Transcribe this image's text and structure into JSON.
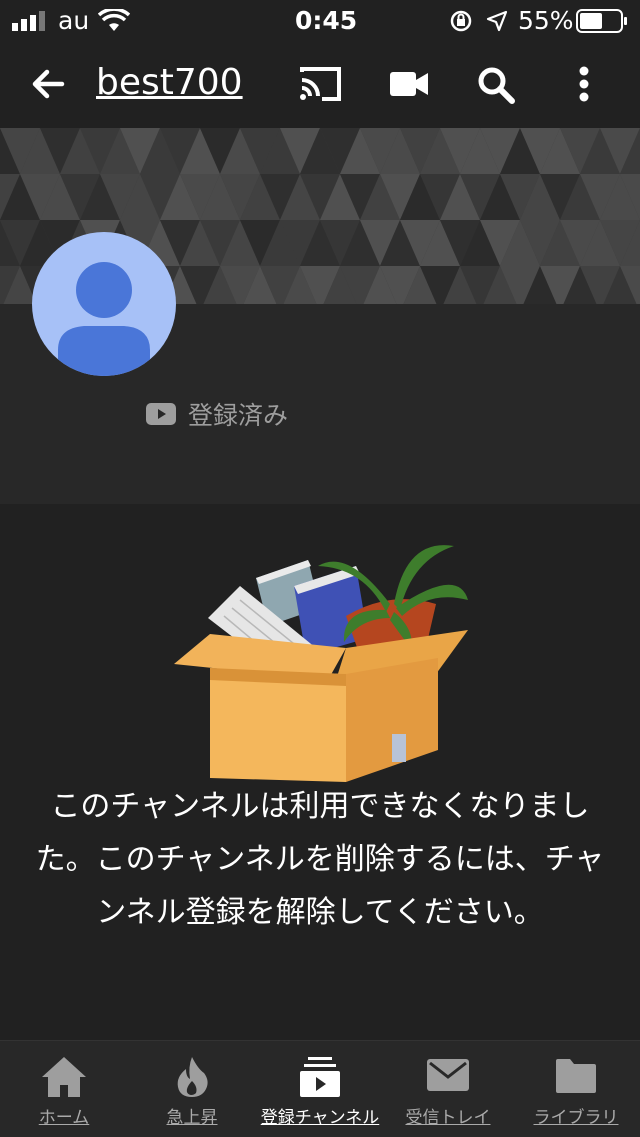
{
  "status_bar": {
    "carrier": "au",
    "time": "0:45",
    "battery": "55%"
  },
  "app_bar": {
    "title": "best700"
  },
  "channel": {
    "subscribe_status": "登録済み"
  },
  "message": "このチャンネルは利用できなくなりました。このチャンネルを削除するには、チャンネル登録を解除してください。",
  "bottom_nav": {
    "items": [
      {
        "label": "ホーム",
        "icon": "home-icon"
      },
      {
        "label": "急上昇",
        "icon": "flame-icon"
      },
      {
        "label": "登録チャンネル",
        "icon": "subscriptions-icon",
        "active": true
      },
      {
        "label": "受信トレイ",
        "icon": "mail-icon"
      },
      {
        "label": "ライブラリ",
        "icon": "folder-icon"
      }
    ]
  },
  "colors": {
    "background": "#212121",
    "avatar": "#a7c1f7",
    "avatar_figure": "#4a76d8",
    "box": "#f4b75c"
  }
}
